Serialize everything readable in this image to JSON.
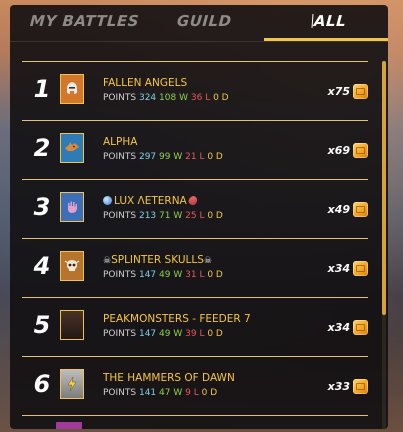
{
  "tabs": [
    {
      "label": "MY BATTLES",
      "active": false
    },
    {
      "label": "GUILD",
      "active": false
    },
    {
      "label": "ALL",
      "active": true
    }
  ],
  "rows": [
    {
      "rank": "1",
      "name": "FALLEN ANGELS",
      "points_label": "POINTS",
      "points": "324",
      "wins": "108 W",
      "losses": "36 L",
      "draws": "0 D",
      "reward": "x75",
      "banner_bg": "#d1782c",
      "emblem": "helmet-icon"
    },
    {
      "rank": "2",
      "name": "ALPHA",
      "points_label": "POINTS",
      "points": "297",
      "wins": "99 W",
      "losses": "21 L",
      "draws": "0 D",
      "reward": "x69",
      "banner_bg": "#2e7bb6",
      "emblem": "wolf-icon"
    },
    {
      "rank": "3",
      "name": "LUX ΛETERNA",
      "points_label": "POINTS",
      "points": "213",
      "wins": "71 W",
      "losses": "25 L",
      "draws": "0 D",
      "reward": "x49",
      "banner_bg": "#3b6fb8",
      "emblem": "hand-icon"
    },
    {
      "rank": "4",
      "name": "SPLINTER SKULLS",
      "points_label": "POINTS",
      "points": "147",
      "wins": "49 W",
      "losses": "31 L",
      "draws": "0 D",
      "reward": "x34",
      "banner_bg": "#b6742f",
      "emblem": "skull-icon"
    },
    {
      "rank": "5",
      "name": "PEAKMONSTERS - FEEDER 7",
      "points_label": "POINTS",
      "points": "147",
      "wins": "49 W",
      "losses": "39 L",
      "draws": "0 D",
      "reward": "x34",
      "banner_bg": "#3a2a24",
      "emblem": "blank-banner-icon"
    },
    {
      "rank": "6",
      "name": "THE HAMMERS OF DAWN",
      "points_label": "POINTS",
      "points": "141",
      "wins": "47 W",
      "losses": "9 L",
      "draws": "0 D",
      "reward": "x33",
      "banner_bg": "#9c9c9c",
      "emblem": "lightning-icon"
    }
  ],
  "colors": {
    "accent": "#f3c44a",
    "points": "#7fd0e6",
    "wins": "#8ed14e",
    "losses": "#e7585e",
    "draws": "#f0c840"
  }
}
